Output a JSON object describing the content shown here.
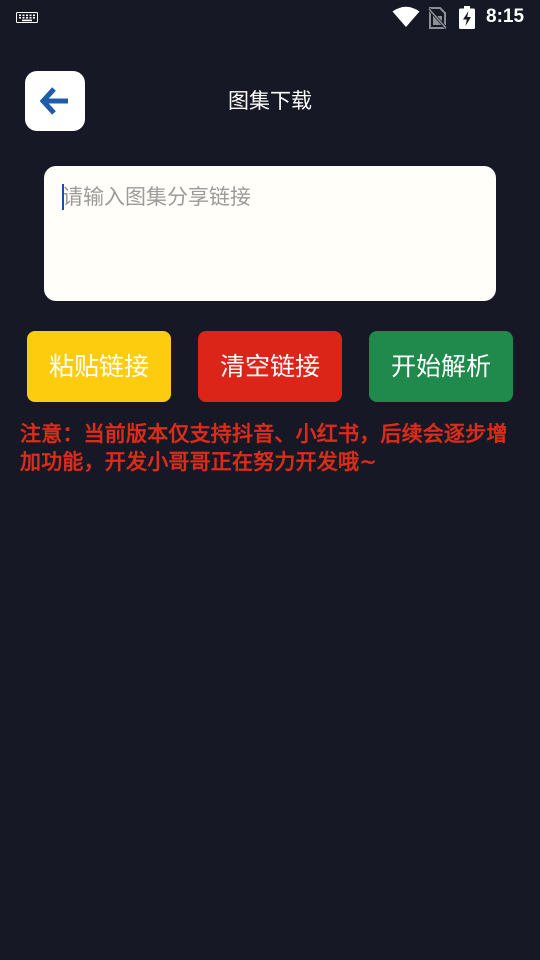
{
  "status_bar": {
    "time": "8:15",
    "icons": [
      "keyboard-icon",
      "wifi-icon",
      "no-sim-icon",
      "battery-charging-icon"
    ]
  },
  "header": {
    "back_icon": "arrow-left-icon",
    "title": "图集下载"
  },
  "input": {
    "value": "",
    "placeholder": "请输入图集分享链接"
  },
  "buttons": {
    "paste": "粘贴链接",
    "clear": "清空链接",
    "parse": "开始解析"
  },
  "notice": {
    "text": "注意：当前版本仅支持抖音、小红书，后续会逐步增加功能，开发小哥哥正在努力开发哦~"
  },
  "colors": {
    "background": "#161925",
    "paste_button": "#fecc0e",
    "clear_button": "#dc2519",
    "parse_button": "#1f8a4b",
    "notice_text": "#dc2b1a",
    "back_arrow": "#1e5ca8"
  }
}
